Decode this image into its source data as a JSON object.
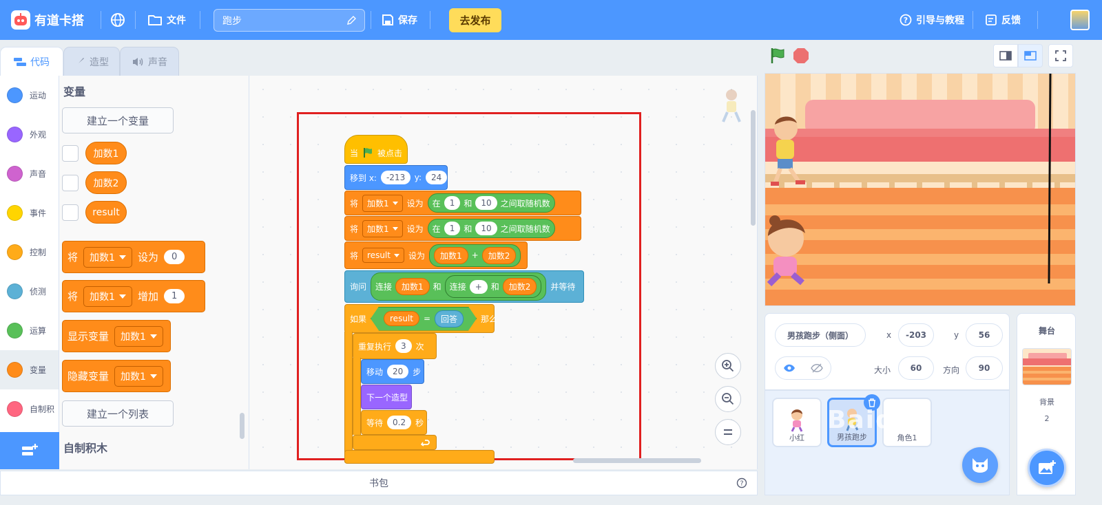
{
  "topbar": {
    "brand": "有道卡搭",
    "file_label": "文件",
    "project_name": "跑步",
    "save_label": "保存",
    "publish_label": "去发布",
    "tutorial_label": "引导与教程",
    "feedback_label": "反馈"
  },
  "tabs": [
    {
      "label": "代码",
      "active": true
    },
    {
      "label": "造型",
      "active": false
    },
    {
      "label": "声音",
      "active": false
    }
  ],
  "categories": [
    {
      "label": "运动",
      "color": "#4c97ff"
    },
    {
      "label": "外观",
      "color": "#9966ff"
    },
    {
      "label": "声音",
      "color": "#cf63cf"
    },
    {
      "label": "事件",
      "color": "#ffd500"
    },
    {
      "label": "控制",
      "color": "#ffab19"
    },
    {
      "label": "侦测",
      "color": "#5cb1d6"
    },
    {
      "label": "运算",
      "color": "#59c059"
    },
    {
      "label": "变量",
      "color": "#ff8c1a"
    },
    {
      "label": "自制积",
      "color": "#ff6680"
    }
  ],
  "palette": {
    "title": "变量",
    "make_variable": "建立一个变量",
    "variables": [
      "加数1",
      "加数2",
      "result"
    ],
    "set_block": {
      "prefix": "将",
      "var": "加数1",
      "action": "设为",
      "value": "0"
    },
    "change_block": {
      "prefix": "将",
      "var": "加数1",
      "action": "增加",
      "value": "1"
    },
    "show_block": {
      "label": "显示变量",
      "var": "加数1"
    },
    "hide_block": {
      "label": "隐藏变量",
      "var": "加数1"
    },
    "make_list": "建立一个列表",
    "my_blocks_title": "自制积木"
  },
  "script": {
    "hat": {
      "when": "当",
      "clicked": "被点击"
    },
    "goto": {
      "label": "移到 x:",
      "x": "-213",
      "ylabel": "y:",
      "y": "24"
    },
    "set1": {
      "prefix": "将",
      "var": "加数1",
      "action": "设为",
      "in": "在",
      "from": "1",
      "and": "和",
      "to": "10",
      "suffix": "之间取随机数"
    },
    "set2": {
      "prefix": "将",
      "var": "加数1",
      "action": "设为",
      "in": "在",
      "from": "1",
      "and": "和",
      "to": "10",
      "suffix": "之间取随机数"
    },
    "set3": {
      "prefix": "将",
      "var": "result",
      "action": "设为",
      "a": "加数1",
      "op": "+",
      "b": "加数2"
    },
    "ask": {
      "label": "询问",
      "join1": "连接",
      "a": "加数1",
      "and1": "和",
      "join2": "连接",
      "op": "+",
      "and2": "和",
      "b": "加数2",
      "wait": "并等待"
    },
    "if_block": {
      "if": "如果",
      "left": "result",
      "eq": "=",
      "right": "回答",
      "then": "那么"
    },
    "repeat": {
      "label": "重复执行",
      "times": "3",
      "unit": "次"
    },
    "move": {
      "label": "移动",
      "steps": "20",
      "unit": "步"
    },
    "next_costume": "下一个造型",
    "wait": {
      "label": "等待",
      "secs": "0.2",
      "unit": "秒"
    }
  },
  "backpack_label": "书包",
  "sprite_info": {
    "name": "男孩跑步（侧面）",
    "x_label": "x",
    "x": "-203",
    "y_label": "y",
    "y": "56",
    "size_label": "大小",
    "size": "60",
    "direction_label": "方向",
    "direction": "90"
  },
  "sprites": [
    {
      "name": "小红",
      "selected": false
    },
    {
      "name": "男孩跑步",
      "selected": true
    },
    {
      "name": "角色1",
      "selected": false
    }
  ],
  "stage_pane": {
    "title": "舞台",
    "backdrop_label": "背景",
    "backdrop_count": "2"
  },
  "watermark": "Baidu"
}
